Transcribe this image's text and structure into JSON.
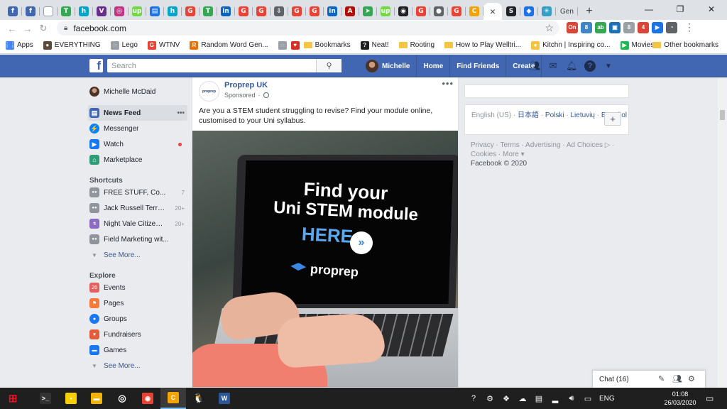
{
  "browser": {
    "tabs": [
      {
        "icon": "facebook-icon",
        "glyph": "f",
        "color": "#4267b2"
      },
      {
        "icon": "facebook-icon",
        "glyph": "f",
        "color": "#4267b2"
      },
      {
        "icon": "page-icon",
        "glyph": "",
        "color": "#ffffff"
      },
      {
        "icon": "green-square-icon",
        "glyph": "T",
        "color": "#34a853"
      },
      {
        "icon": "h-icon",
        "glyph": "h",
        "color": "#00a6c7"
      },
      {
        "icon": "purple-icon",
        "glyph": "V",
        "color": "#6b2d8c"
      },
      {
        "icon": "instagram-icon",
        "glyph": "◎",
        "color": "#c13584"
      },
      {
        "icon": "upwork-icon",
        "glyph": "up",
        "color": "#6fda44"
      },
      {
        "icon": "book-icon",
        "glyph": "▤",
        "color": "#1a73e8"
      },
      {
        "icon": "h-icon",
        "glyph": "h",
        "color": "#00a6c7"
      },
      {
        "icon": "google-icon",
        "glyph": "G",
        "color": "#ea4335"
      },
      {
        "icon": "green-square-icon",
        "glyph": "T",
        "color": "#34a853"
      },
      {
        "icon": "linkedin-icon",
        "glyph": "in",
        "color": "#0a66c2"
      },
      {
        "icon": "google-icon",
        "glyph": "G",
        "color": "#ea4335"
      },
      {
        "icon": "google-icon",
        "glyph": "G",
        "color": "#ea4335"
      },
      {
        "icon": "download-icon",
        "glyph": "⇩",
        "color": "#5f6368"
      },
      {
        "icon": "google-icon",
        "glyph": "G",
        "color": "#ea4335"
      },
      {
        "icon": "google-icon",
        "glyph": "G",
        "color": "#ea4335"
      },
      {
        "icon": "linkedin-icon",
        "glyph": "in",
        "color": "#0a66c2"
      },
      {
        "icon": "acrobat-icon",
        "glyph": "A",
        "color": "#b30b00"
      },
      {
        "icon": "arrow-icon",
        "glyph": "➤",
        "color": "#34a853"
      },
      {
        "icon": "upwork-icon",
        "glyph": "up",
        "color": "#6fda44"
      },
      {
        "icon": "circle-icon",
        "glyph": "◉",
        "color": "#202124"
      },
      {
        "icon": "google-icon",
        "glyph": "G",
        "color": "#ea4335"
      },
      {
        "icon": "globe-icon",
        "glyph": "●",
        "color": "#5f6368"
      },
      {
        "icon": "google-icon",
        "glyph": "G",
        "color": "#ea4335"
      },
      {
        "icon": "orange-c-icon",
        "glyph": "C",
        "color": "#f4a300"
      }
    ],
    "after_tabs": [
      {
        "icon": "s-icon",
        "glyph": "S",
        "color": "#202124"
      },
      {
        "icon": "stack-icon",
        "glyph": "◆",
        "color": "#1a73e8"
      },
      {
        "icon": "asterisk-icon",
        "glyph": "✳",
        "color": "#34a0c7"
      }
    ],
    "active_tab_close": "×",
    "last_tab_label": "Gen",
    "new_tab": "+",
    "window_controls": {
      "minimize": "—",
      "restore": "❐",
      "close": "✕"
    },
    "url": "facebook.com",
    "extensions": [
      {
        "glyph": "On",
        "color": "#db4437"
      },
      {
        "glyph": "8",
        "color": "#3e86c6"
      },
      {
        "glyph": "ab",
        "color": "#34a853"
      },
      {
        "glyph": "▣",
        "color": "#1d6fb8"
      },
      {
        "glyph": "8",
        "color": "#9aa0a6"
      },
      {
        "glyph": "4",
        "color": "#db4437"
      },
      {
        "glyph": "▶",
        "color": "#1a73e8"
      },
      {
        "glyph": "◔",
        "color": "#5f6368"
      }
    ],
    "bookmarks": [
      {
        "label": "Apps",
        "icon": "apps-grid-icon",
        "color": "#4285f4",
        "glyph": "⋮⋮"
      },
      {
        "label": "EVERYTHING",
        "icon": "person-icon",
        "color": "#5b4a3a",
        "glyph": "●"
      },
      {
        "label": "Lego",
        "icon": "globe-icon",
        "color": "#9aa0a6",
        "glyph": "◌"
      },
      {
        "label": "WTNV",
        "icon": "google-icon",
        "color": "#ea4335",
        "glyph": "G"
      },
      {
        "label": "Random Word Gen...",
        "icon": "rw-icon",
        "color": "#e8710a",
        "glyph": "R"
      },
      {
        "label": "",
        "icon": "globe-icon",
        "color": "#9aa0a6",
        "glyph": "◌"
      },
      {
        "label": "",
        "icon": "heart-icon",
        "color": "#d93025",
        "glyph": "♥"
      },
      {
        "label": "Bookmarks",
        "icon": "folder-icon",
        "color": "#f4c542",
        "glyph": ""
      },
      {
        "label": "Neat!",
        "icon": "question-icon",
        "color": "#202124",
        "glyph": "?"
      },
      {
        "label": "Rooting",
        "icon": "folder-icon",
        "color": "#f4c542",
        "glyph": ""
      },
      {
        "label": "How to Play Welltri...",
        "icon": "folder-icon",
        "color": "#f4c542",
        "glyph": ""
      },
      {
        "label": "Kitchn | Inspiring co...",
        "icon": "kitchn-icon",
        "color": "#f4c542",
        "glyph": "●"
      },
      {
        "label": "Movies",
        "icon": "play-icon",
        "color": "#1db954",
        "glyph": "▶"
      }
    ],
    "other_bookmarks": "Other bookmarks"
  },
  "facebook": {
    "logo": "f",
    "search_placeholder": "Search",
    "nav": {
      "user": "Michelle",
      "home": "Home",
      "find_friends": "Find Friends",
      "create": "Create"
    },
    "sidebar": {
      "profile": "Michelle McDaid",
      "main": [
        {
          "label": "News Feed",
          "icon": "news-feed-icon",
          "color": "#4267b2"
        },
        {
          "label": "Messenger",
          "icon": "messenger-icon",
          "color": "#0084ff"
        },
        {
          "label": "Watch",
          "icon": "watch-icon",
          "color": "#1877f2"
        },
        {
          "label": "Marketplace",
          "icon": "marketplace-icon",
          "color": "#2d9d78"
        }
      ],
      "shortcuts_title": "Shortcuts",
      "shortcuts": [
        {
          "label": "FREE STUFF, Co...",
          "count": "7"
        },
        {
          "label": "Jack Russell Terrie...",
          "count": "20+"
        },
        {
          "label": "Night Vale Citizens ...",
          "count": "20+"
        },
        {
          "label": "Field Marketing wit...",
          "count": ""
        }
      ],
      "see_more": "See More...",
      "explore_title": "Explore",
      "explore": [
        {
          "label": "Events",
          "icon": "events-icon",
          "color": "#e4605e",
          "glyph": "26"
        },
        {
          "label": "Pages",
          "icon": "pages-icon",
          "color": "#f5793a",
          "glyph": "⚑"
        },
        {
          "label": "Groups",
          "icon": "groups-icon",
          "color": "#1877f2",
          "glyph": "●"
        },
        {
          "label": "Fundraisers",
          "icon": "fundraisers-icon",
          "color": "#e35d3d",
          "glyph": "♥"
        },
        {
          "label": "Games",
          "icon": "games-icon",
          "color": "#1877f2",
          "glyph": "▬"
        }
      ],
      "see_more_2": "See More..."
    },
    "post": {
      "page_name": "Proprep UK",
      "avatar_text": "proprep",
      "sponsored": "Sponsored",
      "text": "Are you a STEM student struggling to revise? Find your module online, customised to your Uni syllabus.",
      "image": {
        "line1": "Find your",
        "line2": "Uni STEM module",
        "line3": "HERE",
        "brand": "proprep"
      }
    },
    "right": {
      "lang_current": "English (US)",
      "languages": [
        "日本語",
        "Polski",
        "Lietuvių",
        "Español"
      ],
      "footer_links": "Privacy · Terms · Advertising · Ad Choices ▷ · Cookies · More ▾",
      "copyright": "Facebook © 2020"
    },
    "chat_label": "Chat (16)"
  },
  "taskbar": {
    "apps": [
      {
        "icon": "windows-start-icon",
        "color": "#e81123",
        "glyph": "⊞"
      },
      {
        "icon": "terminal-icon",
        "color": "#333333",
        "glyph": ">_"
      },
      {
        "icon": "sticky-notes-icon",
        "color": "#f7d000",
        "glyph": "▪"
      },
      {
        "icon": "file-explorer-icon",
        "color": "#f2b400",
        "glyph": "▬"
      },
      {
        "icon": "circle-app-icon",
        "color": "#ffffff",
        "glyph": "◎"
      },
      {
        "icon": "chrome-icon",
        "color": "#ea4335",
        "glyph": "◉"
      },
      {
        "icon": "orange-app-icon",
        "color": "#f4a300",
        "glyph": "C"
      },
      {
        "icon": "penguin-icon",
        "color": "#ffffff",
        "glyph": "🐧"
      },
      {
        "icon": "word-icon",
        "color": "#2b579a",
        "glyph": "W"
      }
    ],
    "tray_lang": "ENG",
    "time": "01:08",
    "date": "26/03/2020"
  }
}
